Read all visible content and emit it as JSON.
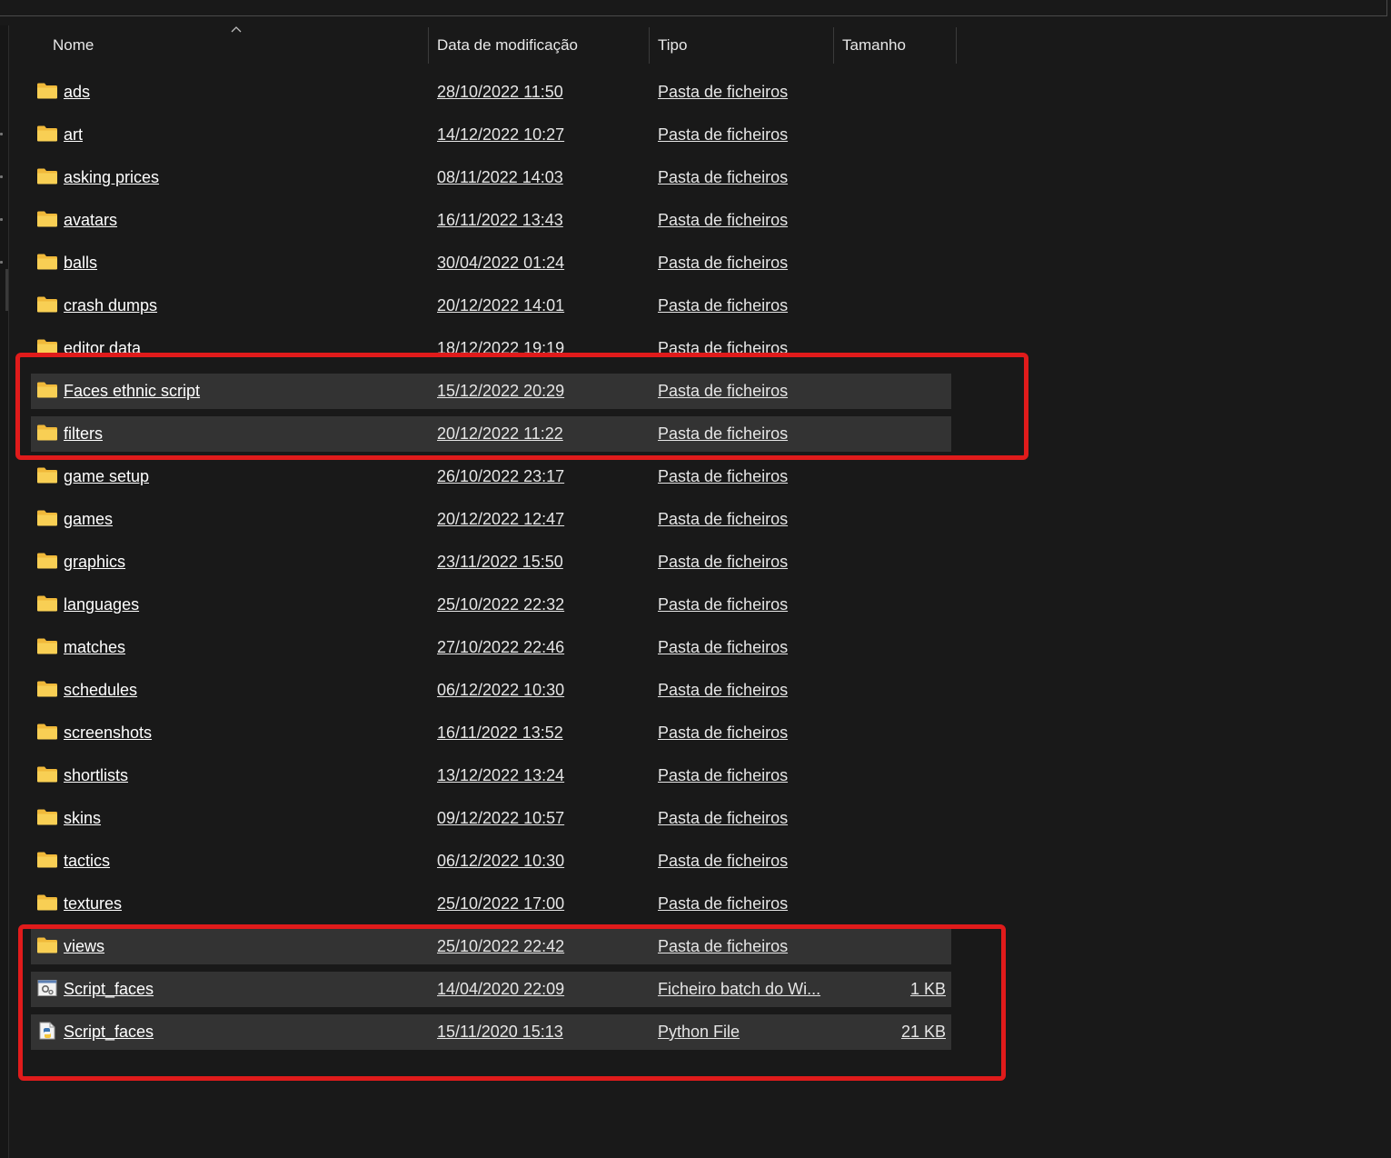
{
  "header": {
    "name": "Nome",
    "date": "Data de modificação",
    "type": "Tipo",
    "size": "Tamanho"
  },
  "colors": {
    "background": "#191919",
    "selected_row": "#333333",
    "highlight_box": "#e01b1b",
    "folder": "#f3c03f"
  },
  "rows": [
    {
      "name": "ads",
      "date": "28/10/2022 11:50",
      "type": "Pasta de ficheiros",
      "size": "",
      "icon": "folder-icon",
      "selected": false
    },
    {
      "name": "art",
      "date": "14/12/2022 10:27",
      "type": "Pasta de ficheiros",
      "size": "",
      "icon": "folder-icon",
      "selected": false
    },
    {
      "name": "asking prices",
      "date": "08/11/2022 14:03",
      "type": "Pasta de ficheiros",
      "size": "",
      "icon": "folder-icon",
      "selected": false
    },
    {
      "name": "avatars",
      "date": "16/11/2022 13:43",
      "type": "Pasta de ficheiros",
      "size": "",
      "icon": "folder-icon",
      "selected": false
    },
    {
      "name": "balls",
      "date": "30/04/2022 01:24",
      "type": "Pasta de ficheiros",
      "size": "",
      "icon": "folder-icon",
      "selected": false
    },
    {
      "name": "crash dumps",
      "date": "20/12/2022 14:01",
      "type": "Pasta de ficheiros",
      "size": "",
      "icon": "folder-icon",
      "selected": false
    },
    {
      "name": "editor data",
      "date": "18/12/2022 19:19",
      "type": "Pasta de ficheiros",
      "size": "",
      "icon": "folder-icon",
      "selected": false
    },
    {
      "name": "Faces ethnic script",
      "date": "15/12/2022 20:29",
      "type": "Pasta de ficheiros",
      "size": "",
      "icon": "folder-icon",
      "selected": true
    },
    {
      "name": "filters",
      "date": "20/12/2022 11:22",
      "type": "Pasta de ficheiros",
      "size": "",
      "icon": "folder-icon",
      "selected": true
    },
    {
      "name": "game setup",
      "date": "26/10/2022 23:17",
      "type": "Pasta de ficheiros",
      "size": "",
      "icon": "folder-icon",
      "selected": false
    },
    {
      "name": "games",
      "date": "20/12/2022 12:47",
      "type": "Pasta de ficheiros",
      "size": "",
      "icon": "folder-icon",
      "selected": false
    },
    {
      "name": "graphics",
      "date": "23/11/2022 15:50",
      "type": "Pasta de ficheiros",
      "size": "",
      "icon": "folder-icon",
      "selected": false
    },
    {
      "name": "languages",
      "date": "25/10/2022 22:32",
      "type": "Pasta de ficheiros",
      "size": "",
      "icon": "folder-icon",
      "selected": false
    },
    {
      "name": "matches",
      "date": "27/10/2022 22:46",
      "type": "Pasta de ficheiros",
      "size": "",
      "icon": "folder-icon",
      "selected": false
    },
    {
      "name": "schedules",
      "date": "06/12/2022 10:30",
      "type": "Pasta de ficheiros",
      "size": "",
      "icon": "folder-icon",
      "selected": false
    },
    {
      "name": "screenshots",
      "date": "16/11/2022 13:52",
      "type": "Pasta de ficheiros",
      "size": "",
      "icon": "folder-icon",
      "selected": false
    },
    {
      "name": "shortlists",
      "date": "13/12/2022 13:24",
      "type": "Pasta de ficheiros",
      "size": "",
      "icon": "folder-icon",
      "selected": false
    },
    {
      "name": "skins",
      "date": "09/12/2022 10:57",
      "type": "Pasta de ficheiros",
      "size": "",
      "icon": "folder-icon",
      "selected": false
    },
    {
      "name": "tactics",
      "date": "06/12/2022 10:30",
      "type": "Pasta de ficheiros",
      "size": "",
      "icon": "folder-icon",
      "selected": false
    },
    {
      "name": "textures",
      "date": "25/10/2022 17:00",
      "type": "Pasta de ficheiros",
      "size": "",
      "icon": "folder-icon",
      "selected": false
    },
    {
      "name": "views",
      "date": "25/10/2022 22:42",
      "type": "Pasta de ficheiros",
      "size": "",
      "icon": "folder-icon",
      "selected": true
    },
    {
      "name": "Script_faces",
      "date": "14/04/2020 22:09",
      "type": "Ficheiro batch do Wi...",
      "size": "1 KB",
      "icon": "batch-file-icon",
      "selected": true
    },
    {
      "name": "Script_faces",
      "date": "15/11/2020 15:13",
      "type": "Python File",
      "size": "21 KB",
      "icon": "python-file-icon",
      "selected": true
    }
  ]
}
